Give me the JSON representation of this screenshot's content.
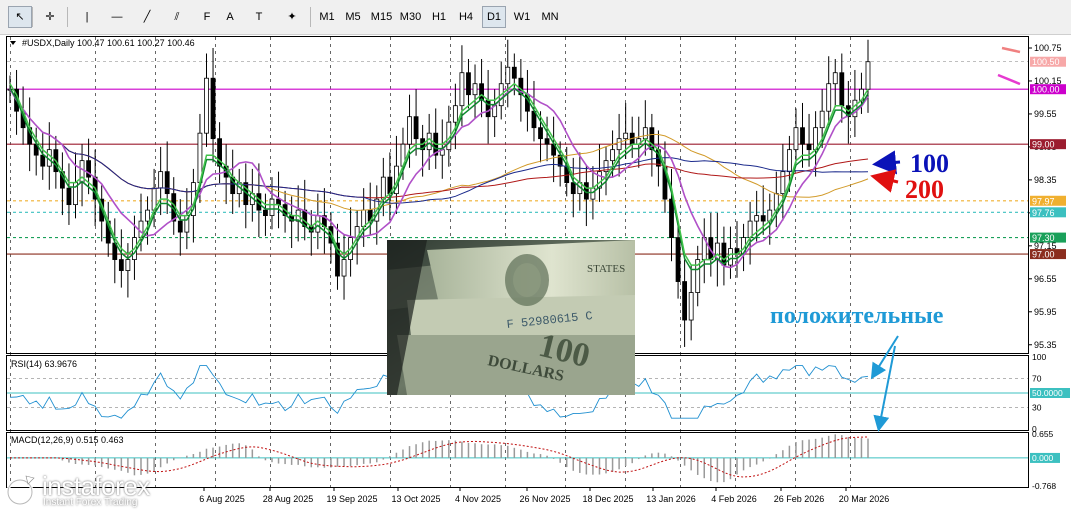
{
  "toolbar": {
    "draw_tools": [
      "cursor",
      "crosshair",
      "vertical-line",
      "horizontal-line",
      "trend-line",
      "channel",
      "fibonacci",
      "text",
      "label",
      "shapes"
    ],
    "timeframes": [
      "M1",
      "M5",
      "M15",
      "M30",
      "H1",
      "H4",
      "D1",
      "W1",
      "MN"
    ],
    "active_timeframe": "D1"
  },
  "chart_data": [
    {
      "type": "line",
      "title": "#USDX,Daily  100.47 100.61 100.27 100.46",
      "price_axis_ticks": [
        "100.75",
        "100.15",
        "99.55",
        "98.95",
        "98.35",
        "97.75",
        "97.15",
        "96.55",
        "95.95",
        "95.35"
      ],
      "price_labels": [
        {
          "value": "100.50",
          "color": "#f7a8a8"
        },
        {
          "value": "100.00",
          "color": "#cc00cc"
        },
        {
          "value": "99.00",
          "color": "#9b1c2f"
        },
        {
          "value": "97.97",
          "color": "#f0b030"
        },
        {
          "value": "97.76",
          "color": "#3cc0c0"
        },
        {
          "value": "97.30",
          "color": "#1aa05a"
        },
        {
          "value": "97.00",
          "color": "#8b2d1e"
        }
      ],
      "date_labels": [
        "6 Aug 2025",
        "28 Aug 2025",
        "19 Sep 2025",
        "13 Oct 2025",
        "4 Nov 2025",
        "26 Nov 2025",
        "18 Dec 2025",
        "13 Jan 2026",
        "4 Feb 2026",
        "26 Feb 2026",
        "20 Mar 2026"
      ],
      "annotations": [
        {
          "text": "100",
          "color": "#0a12b8"
        },
        {
          "text": "200",
          "color": "#e01010"
        },
        {
          "text": "положительные",
          "color": "#1f9ad6"
        }
      ],
      "ylim": [
        95.2,
        100.95
      ],
      "close": [
        100.0,
        99.6,
        99.3,
        99.0,
        98.8,
        98.6,
        98.9,
        98.5,
        98.2,
        97.9,
        98.3,
        98.7,
        98.4,
        98.0,
        97.6,
        97.2,
        96.9,
        96.7,
        96.9,
        97.3,
        97.6,
        97.8,
        98.2,
        98.5,
        98.1,
        97.6,
        97.4,
        97.7,
        98.3,
        99.2,
        100.2,
        99.1,
        98.6,
        98.4,
        98.1,
        98.3,
        97.9,
        98.1,
        97.8,
        97.7,
        98.0,
        97.9,
        97.7,
        97.6,
        97.8,
        97.5,
        97.4,
        97.7,
        97.5,
        97.2,
        96.6,
        96.9,
        97.3,
        97.5,
        97.8,
        97.6,
        98.0,
        98.4,
        98.1,
        98.6,
        99.0,
        99.5,
        99.1,
        98.9,
        99.2,
        98.8,
        98.9,
        99.4,
        99.7,
        100.3,
        99.9,
        100.1,
        99.8,
        99.5,
        99.7,
        100.1,
        100.4,
        100.2,
        99.9,
        99.6,
        99.3,
        99.1,
        99.0,
        98.8,
        98.6,
        98.3,
        98.1,
        98.3,
        98.0,
        98.2,
        98.5,
        98.7,
        98.9,
        99.1,
        99.2,
        99.0,
        99.1,
        99.3,
        98.9,
        98.6,
        98.0,
        97.3,
        96.5,
        95.8,
        96.3,
        96.9,
        97.3,
        96.9,
        97.2,
        96.8,
        97.1,
        97.0,
        97.3,
        97.6,
        97.7,
        97.6,
        97.8,
        98.1,
        98.5,
        98.9,
        99.3,
        99.0,
        98.9,
        99.3,
        99.6,
        100.1,
        100.3,
        99.7,
        99.5,
        99.8,
        100.0,
        100.5
      ],
      "ma_fast": [
        100.1,
        99.9,
        99.6,
        99.3,
        99.1,
        98.9,
        98.8,
        98.7,
        98.5,
        98.3,
        98.3,
        98.4,
        98.3,
        98.2,
        97.9,
        97.6,
        97.3,
        97.1,
        97.0,
        97.1,
        97.3,
        97.5,
        97.8,
        98.0,
        98.0,
        97.9,
        97.7,
        97.7,
        97.9,
        98.3,
        98.8,
        98.8,
        98.7,
        98.6,
        98.4,
        98.3,
        98.2,
        98.1,
        98.0,
        97.9,
        97.9,
        97.9,
        97.8,
        97.7,
        97.7,
        97.6,
        97.5,
        97.6,
        97.5,
        97.4,
        97.1,
        97.0,
        97.1,
        97.3,
        97.5,
        97.6,
        97.8,
        98.0,
        98.1,
        98.3,
        98.6,
        98.9,
        99.0,
        99.0,
        99.1,
        99.0,
        99.0,
        99.1,
        99.3,
        99.6,
        99.7,
        99.8,
        99.9,
        99.8,
        99.8,
        99.9,
        100.0,
        100.1,
        100.0,
        99.9,
        99.7,
        99.5,
        99.3,
        99.1,
        98.9,
        98.7,
        98.4,
        98.3,
        98.2,
        98.2,
        98.3,
        98.4,
        98.6,
        98.8,
        98.9,
        99.0,
        99.0,
        99.1,
        99.0,
        98.9,
        98.6,
        98.2,
        97.6,
        97.0,
        96.8,
        96.8,
        96.9,
        96.9,
        97.0,
        96.9,
        97.0,
        97.0,
        97.1,
        97.3,
        97.4,
        97.5,
        97.6,
        97.8,
        98.0,
        98.3,
        98.7,
        98.8,
        98.8,
        98.9,
        99.1,
        99.4,
        99.7,
        99.7,
        99.6,
        99.7,
        99.8,
        100.0
      ]
    },
    {
      "type": "line",
      "title": "RSI(14) 63.9676",
      "y_ticks": [
        "100",
        "70",
        "50.0000",
        "30",
        "0"
      ],
      "ylim": [
        0,
        100
      ]
    },
    {
      "type": "bar",
      "title": "MACD(12,26,9) 0.515 0.463",
      "y_ticks": [
        "0.655",
        "0.000",
        "-0.768"
      ],
      "ylim": [
        -0.768,
        0.655
      ]
    }
  ],
  "brand": {
    "name": "instaforex",
    "tagline": "Instant Forex Trading"
  }
}
